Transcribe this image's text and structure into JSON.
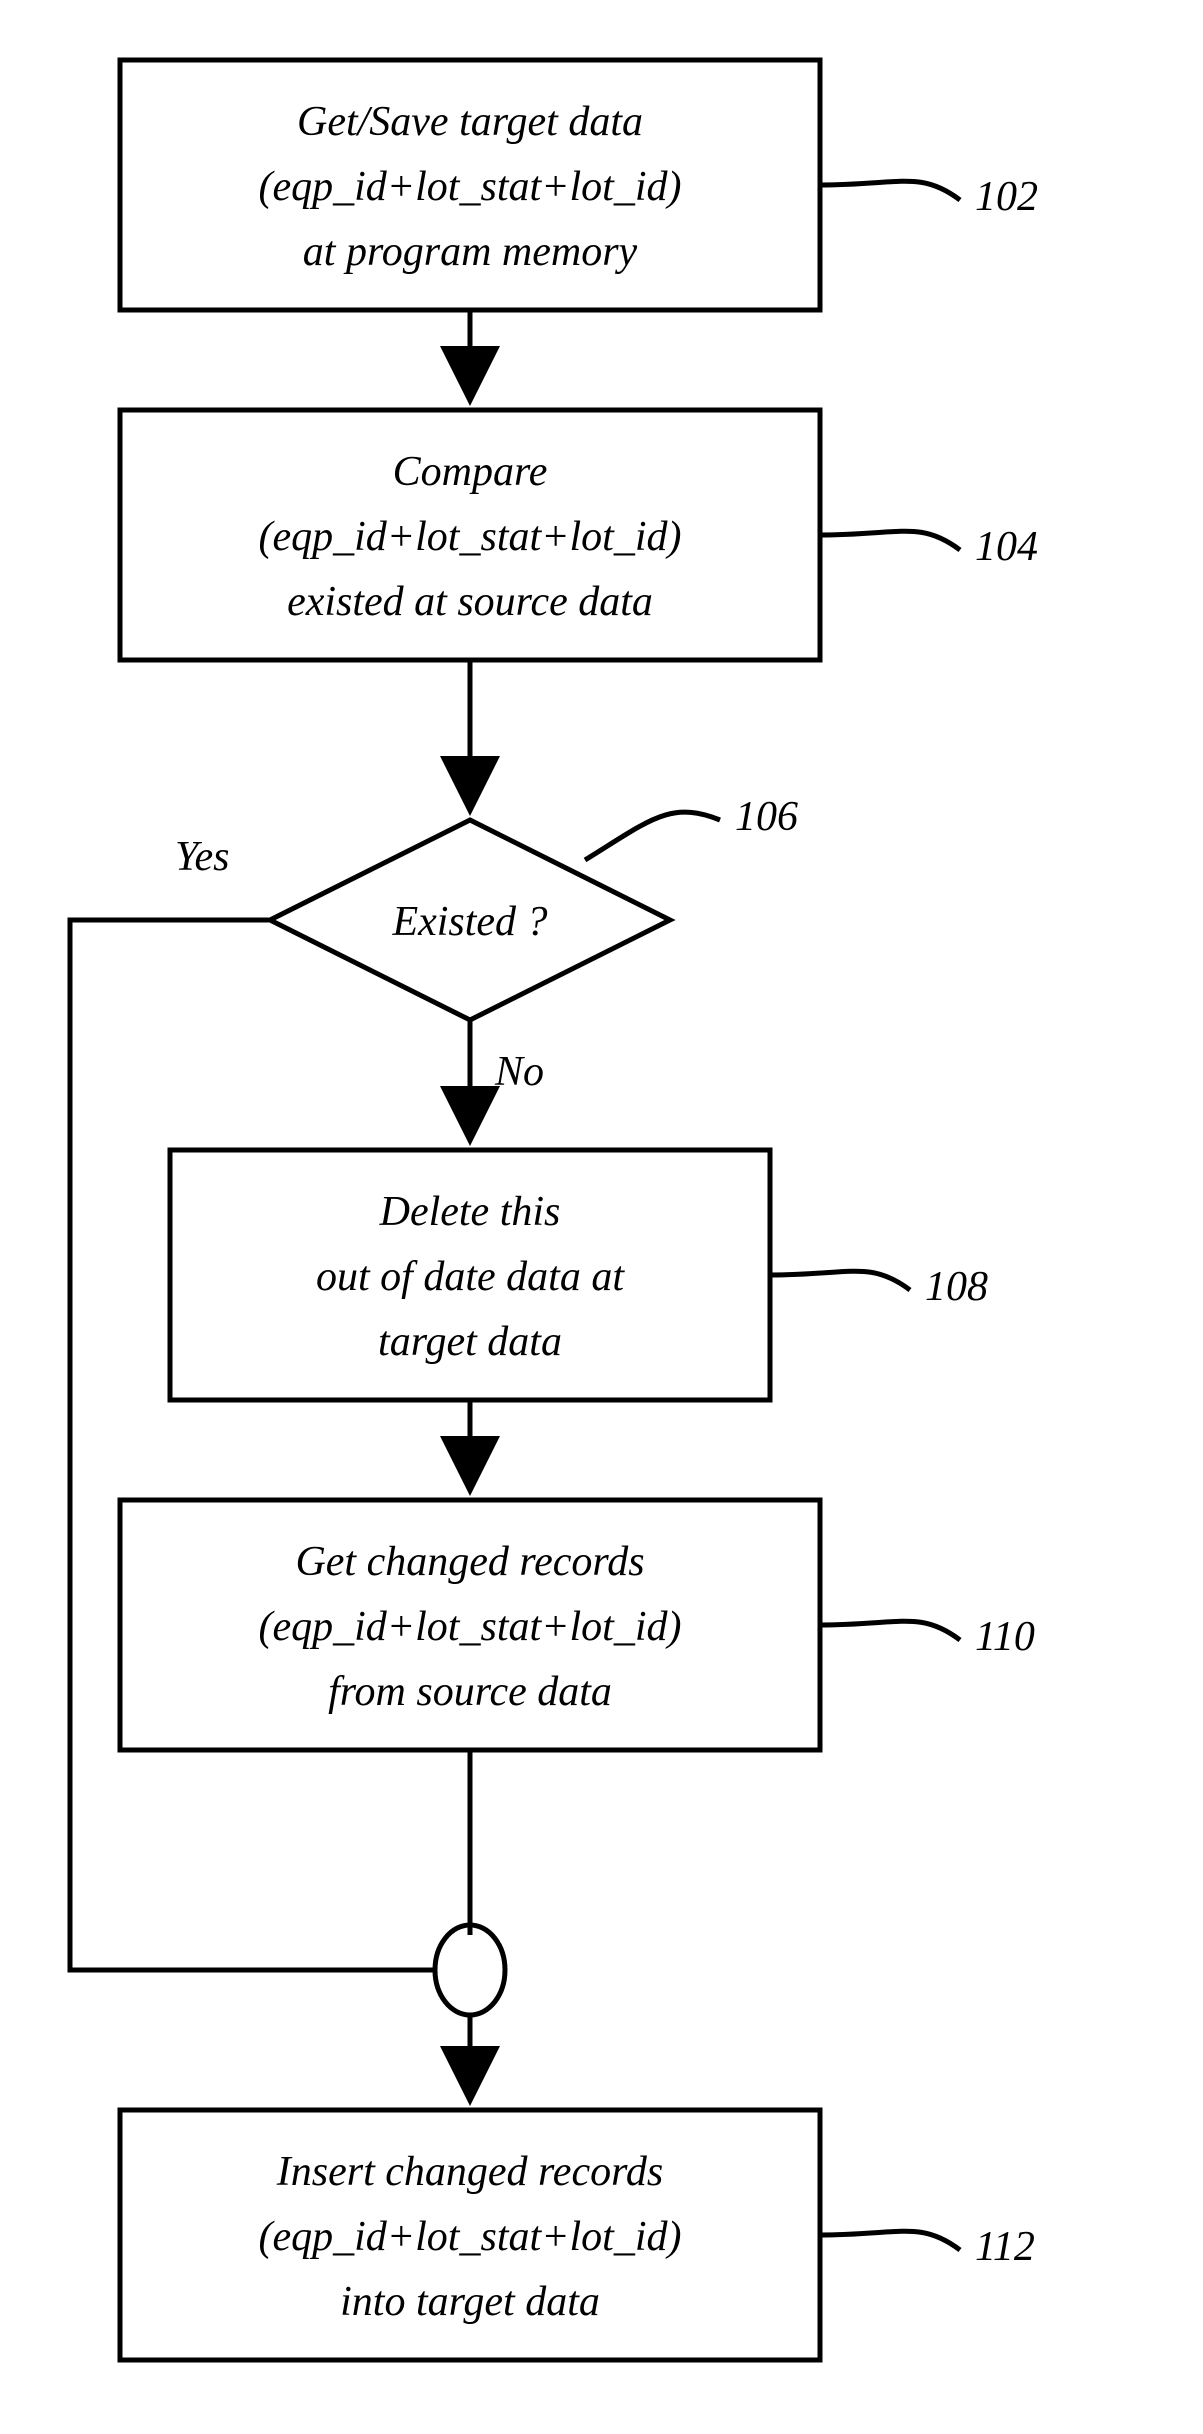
{
  "chart_data": {
    "type": "flowchart",
    "nodes": [
      {
        "id": "102",
        "shape": "rect",
        "lines": [
          "Get/Save target data",
          "(eqp_id+lot_stat+lot_id)",
          "at program memory"
        ]
      },
      {
        "id": "104",
        "shape": "rect",
        "lines": [
          "Compare",
          "(eqp_id+lot_stat+lot_id)",
          "existed at source data"
        ]
      },
      {
        "id": "106",
        "shape": "diamond",
        "lines": [
          "Existed ?"
        ]
      },
      {
        "id": "108",
        "shape": "rect",
        "lines": [
          "Delete this",
          "out of date data at",
          "target data"
        ]
      },
      {
        "id": "110",
        "shape": "rect",
        "lines": [
          "Get changed records",
          "(eqp_id+lot_stat+lot_id)",
          "from source data"
        ]
      },
      {
        "id": "112",
        "shape": "rect",
        "lines": [
          "Insert changed records",
          "(eqp_id+lot_stat+lot_id)",
          "into target data"
        ]
      }
    ],
    "edges": [
      {
        "from": "102",
        "to": "104",
        "label": ""
      },
      {
        "from": "104",
        "to": "106",
        "label": ""
      },
      {
        "from": "106",
        "to": "108",
        "label": "No"
      },
      {
        "from": "106",
        "to": "join",
        "label": "Yes"
      },
      {
        "from": "108",
        "to": "110",
        "label": ""
      },
      {
        "from": "110",
        "to": "join",
        "label": ""
      },
      {
        "from": "join",
        "to": "112",
        "label": ""
      }
    ],
    "labels": {
      "yes": "Yes",
      "no": "No"
    },
    "refs": {
      "n102": "102",
      "n104": "104",
      "n106": "106",
      "n108": "108",
      "n110": "110",
      "n112": "112"
    }
  }
}
